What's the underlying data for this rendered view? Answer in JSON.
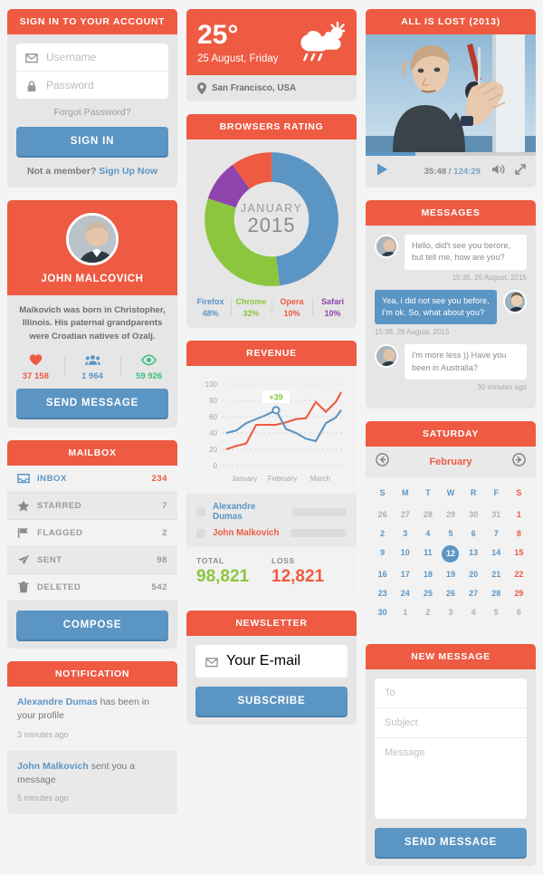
{
  "signin": {
    "title": "SIGN IN TO YOUR ACCOUNT",
    "username_placeholder": "Username",
    "password_placeholder": "Password",
    "forgot": "Forgot Password?",
    "submit": "SIGN IN",
    "footer_text": "Not a member?",
    "footer_link": "Sign Up Now"
  },
  "profile": {
    "name": "JOHN MALCOVICH",
    "bio": "Malkovich was born in Christopher, Illinois. His paternal grandparents were Croatian natives of Ozalj.",
    "stats": [
      {
        "icon": "heart-icon",
        "value": "37 158",
        "color": "#ee5a42"
      },
      {
        "icon": "people-icon",
        "value": "1 964",
        "color": "#5b95c4"
      },
      {
        "icon": "eye-icon",
        "value": "59 926",
        "color": "#3cbf7e"
      }
    ],
    "action": "SEND MESSAGE"
  },
  "mailbox": {
    "title": "MAILBOX",
    "items": [
      {
        "icon": "inbox-icon",
        "label": "INBOX",
        "count": "234",
        "active": true
      },
      {
        "icon": "star-icon",
        "label": "STARRED",
        "count": "7",
        "active": false
      },
      {
        "icon": "flag-icon",
        "label": "FLAGGED",
        "count": "2",
        "active": false
      },
      {
        "icon": "send-icon",
        "label": "SENT",
        "count": "98",
        "active": false
      },
      {
        "icon": "trash-icon",
        "label": "DELETED",
        "count": "542",
        "active": false
      }
    ],
    "compose": "COMPOSE"
  },
  "notification": {
    "title": "NOTIFICATION",
    "items": [
      {
        "who": "Alexandre Dumas",
        "text": " has been in your profile",
        "when": "3 minutes ago"
      },
      {
        "who": "John Malkovich",
        "text": " sent you a message",
        "when": "5 minutes ago"
      }
    ]
  },
  "weather": {
    "temperature": "25°",
    "date": "25 August, Friday",
    "location": "San Francisco, USA",
    "icon": "sun-cloud-rain-icon"
  },
  "browsers": {
    "title": "BROWSERS RATING",
    "center_month": "JANUARY",
    "center_year": "2015"
  },
  "revenue": {
    "title": "REVENUE",
    "badge": "+39",
    "series_legend": [
      {
        "name": "Alexandre Dumas",
        "color": "#5b95c4",
        "bar_pct": 78
      },
      {
        "name": "John Malkovich",
        "color": "#ee5a42",
        "bar_pct": 96
      }
    ],
    "total_label": "TOTAL",
    "total_value": "98,821",
    "loss_label": "LOSS",
    "loss_value": "12,821"
  },
  "newsletter": {
    "title": "NEWSLETTER",
    "placeholder": "Your E-mail",
    "submit": "SUBSCRIBE"
  },
  "video": {
    "title": "ALL IS LOST (2013)",
    "current_time": "35:48",
    "separator": " / ",
    "duration": "124:29",
    "play_icon": "play-icon",
    "volume_icon": "volume-icon",
    "fullscreen_icon": "fullscreen-icon"
  },
  "messages": {
    "title": "MESSAGES",
    "items": [
      {
        "side": "in",
        "text": "Hello, did't see you berore, but tell me, how are you?",
        "stamp": "15:35, 26 August, 2015"
      },
      {
        "side": "out",
        "text": "Yea, i did not see you before, I'm ok. So, what about you?",
        "stamp": "15:38, 26 August, 2015"
      },
      {
        "side": "in",
        "text": "I'm more less )) Have you been in Australia?",
        "stamp": "30 minutes ago"
      }
    ]
  },
  "calendar": {
    "title": "SATURDAY",
    "month": "February",
    "prev_icon": "arrow-left-circle-icon",
    "next_icon": "arrow-right-circle-icon",
    "dow": [
      "S",
      "M",
      "T",
      "W",
      "R",
      "F",
      "S"
    ],
    "weeks": [
      [
        {
          "d": "26",
          "t": "mut"
        },
        {
          "d": "27",
          "t": "mut"
        },
        {
          "d": "28",
          "t": "mut"
        },
        {
          "d": "29",
          "t": "mut"
        },
        {
          "d": "30",
          "t": "mut"
        },
        {
          "d": "31",
          "t": "mut"
        },
        {
          "d": "1",
          "t": "red"
        }
      ],
      [
        {
          "d": "2",
          "t": ""
        },
        {
          "d": "3",
          "t": ""
        },
        {
          "d": "4",
          "t": ""
        },
        {
          "d": "5",
          "t": ""
        },
        {
          "d": "6",
          "t": ""
        },
        {
          "d": "7",
          "t": ""
        },
        {
          "d": "8",
          "t": "red"
        }
      ],
      [
        {
          "d": "9",
          "t": ""
        },
        {
          "d": "10",
          "t": ""
        },
        {
          "d": "11",
          "t": ""
        },
        {
          "d": "12",
          "t": "sel"
        },
        {
          "d": "13",
          "t": ""
        },
        {
          "d": "14",
          "t": ""
        },
        {
          "d": "15",
          "t": "red"
        }
      ],
      [
        {
          "d": "16",
          "t": ""
        },
        {
          "d": "17",
          "t": ""
        },
        {
          "d": "18",
          "t": ""
        },
        {
          "d": "19",
          "t": ""
        },
        {
          "d": "20",
          "t": ""
        },
        {
          "d": "21",
          "t": ""
        },
        {
          "d": "22",
          "t": "red"
        }
      ],
      [
        {
          "d": "23",
          "t": ""
        },
        {
          "d": "24",
          "t": ""
        },
        {
          "d": "25",
          "t": ""
        },
        {
          "d": "26",
          "t": ""
        },
        {
          "d": "27",
          "t": ""
        },
        {
          "d": "28",
          "t": ""
        },
        {
          "d": "29",
          "t": "red"
        }
      ],
      [
        {
          "d": "30",
          "t": ""
        },
        {
          "d": "1",
          "t": "mut"
        },
        {
          "d": "2",
          "t": "mut"
        },
        {
          "d": "3",
          "t": "mut"
        },
        {
          "d": "4",
          "t": "mut"
        },
        {
          "d": "5",
          "t": "mut"
        },
        {
          "d": "6",
          "t": "mut"
        }
      ]
    ]
  },
  "new_message": {
    "title": "NEW MESSAGE",
    "to_placeholder": "To",
    "subject_placeholder": "Subject",
    "message_placeholder": "Message",
    "submit": "SEND MESSAGE"
  },
  "colors": {
    "accent_orange": "#ee5a42",
    "accent_blue": "#5b95c4",
    "green": "#8cc63f",
    "purple": "#8e44ad",
    "panel_grey": "#e6e6e6"
  },
  "chart_data": [
    {
      "type": "pie",
      "title": "BROWSERS RATING",
      "center_label": "JANUARY 2015",
      "legend_position": "bottom",
      "labels": [
        "Firefox",
        "Chrome",
        "Opera",
        "Safari"
      ],
      "values": [
        48,
        32,
        10,
        10
      ],
      "value_labels": [
        "48%",
        "32%",
        "10%",
        "10%"
      ],
      "colors": [
        "#5b95c4",
        "#8cc63f",
        "#ee5a42",
        "#8e44ad"
      ],
      "donut": true
    },
    {
      "type": "line",
      "title": "REVENUE",
      "xlabel": "",
      "ylabel": "",
      "ylim": [
        0,
        100
      ],
      "yticks": [
        0,
        20,
        40,
        60,
        80,
        100
      ],
      "x": [
        "January",
        "February",
        "March"
      ],
      "grid": true,
      "annotation": {
        "text": "+39",
        "x_index": 5,
        "value": 68
      },
      "series": [
        {
          "name": "Alexandre Dumas",
          "color": "#5b95c4",
          "values": [
            40,
            43,
            52,
            57,
            62,
            68,
            45,
            40,
            33,
            30,
            52,
            59,
            68
          ]
        },
        {
          "name": "John Malkovich",
          "color": "#ee5a42",
          "values": [
            20,
            24,
            27,
            50,
            50,
            50,
            53,
            57,
            58,
            78,
            66,
            78,
            89
          ]
        }
      ],
      "totals": {
        "TOTAL": "98,821",
        "LOSS": "12,821"
      }
    }
  ]
}
